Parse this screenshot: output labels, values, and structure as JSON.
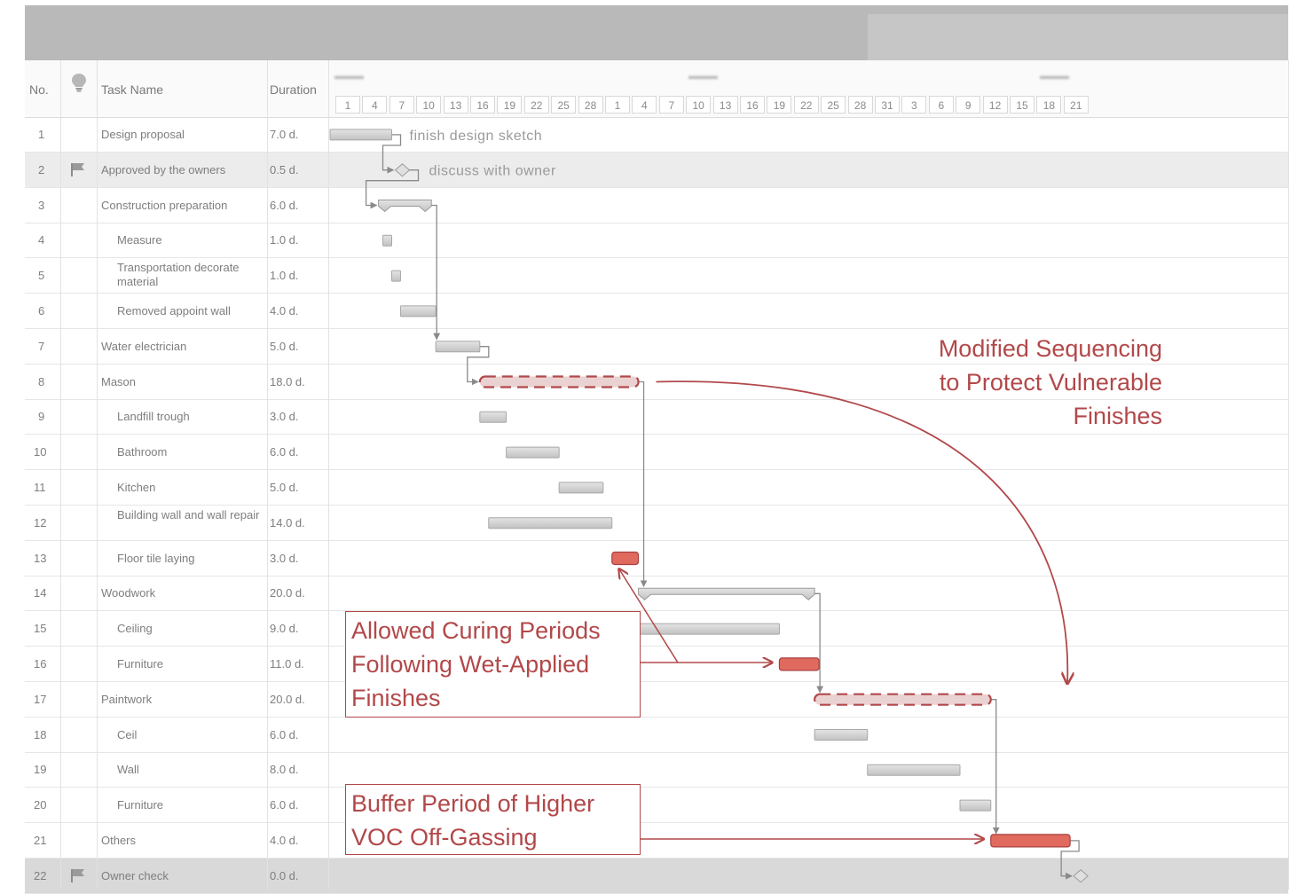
{
  "header": {
    "no_label": "No.",
    "task_label": "Task Name",
    "duration_label": "Duration"
  },
  "timeline": {
    "days": [
      "1",
      "4",
      "7",
      "10",
      "13",
      "16",
      "19",
      "22",
      "25",
      "28",
      "1",
      "4",
      "7",
      "10",
      "13",
      "16",
      "19",
      "22",
      "25",
      "28",
      "31",
      "3",
      "6",
      "9",
      "12",
      "15",
      "18",
      "21"
    ]
  },
  "chart_data": {
    "type": "gantt",
    "tasks": [
      {
        "no": "1",
        "name": "Design proposal",
        "duration": "7.0 d.",
        "level": 0,
        "kind": "task",
        "start": 0,
        "days": 7,
        "label": "finish design sketch"
      },
      {
        "no": "2",
        "name": "Approved by the owners",
        "duration": "0.5 d.",
        "level": 0,
        "kind": "milestone",
        "start": 7,
        "days": 0.5,
        "label": "discuss with owner",
        "flag": true
      },
      {
        "no": "3",
        "name": "Construction preparation",
        "duration": "6.0 d.",
        "level": 0,
        "kind": "summary",
        "start": 5.5,
        "days": 6
      },
      {
        "no": "4",
        "name": "Measure",
        "duration": "1.0 d.",
        "level": 1,
        "kind": "task",
        "start": 6,
        "days": 1
      },
      {
        "no": "5",
        "name": "Transportation decorate material",
        "duration": "1.0 d.",
        "level": 1,
        "kind": "task",
        "start": 7,
        "days": 1
      },
      {
        "no": "6",
        "name": "Removed appoint wall",
        "duration": "4.0 d.",
        "level": 1,
        "kind": "task",
        "start": 8,
        "days": 4
      },
      {
        "no": "7",
        "name": "Water electrician",
        "duration": "5.0 d.",
        "level": 0,
        "kind": "task",
        "start": 12,
        "days": 5
      },
      {
        "no": "8",
        "name": "Mason",
        "duration": "18.0 d.",
        "level": 0,
        "kind": "summary",
        "start": 17,
        "days": 18,
        "highlight": "dashed"
      },
      {
        "no": "9",
        "name": "Landfill trough",
        "duration": "3.0 d.",
        "level": 1,
        "kind": "task",
        "start": 17,
        "days": 3
      },
      {
        "no": "10",
        "name": "Bathroom",
        "duration": "6.0 d.",
        "level": 1,
        "kind": "task",
        "start": 20,
        "days": 6
      },
      {
        "no": "11",
        "name": "Kitchen",
        "duration": "5.0 d.",
        "level": 1,
        "kind": "task",
        "start": 26,
        "days": 5
      },
      {
        "no": "12",
        "name": "Building wall and wall repair",
        "duration": "14.0 d.",
        "level": 1,
        "kind": "task",
        "start": 18,
        "days": 14
      },
      {
        "no": "13",
        "name": "Floor tile laying",
        "duration": "3.0 d.",
        "level": 1,
        "kind": "task",
        "start": 32,
        "days": 3,
        "highlight": "red"
      },
      {
        "no": "14",
        "name": "Woodwork",
        "duration": "20.0 d.",
        "level": 0,
        "kind": "summary",
        "start": 35,
        "days": 20
      },
      {
        "no": "15",
        "name": "Ceiling",
        "duration": "9.0 d.",
        "level": 1,
        "kind": "task",
        "start": 35,
        "days": 16
      },
      {
        "no": "16",
        "name": "Furniture",
        "duration": "11.0 d.",
        "level": 1,
        "kind": "task",
        "start": 51,
        "days": 4.5,
        "highlight": "red"
      },
      {
        "no": "17",
        "name": "Paintwork",
        "duration": "20.0 d.",
        "level": 0,
        "kind": "summary",
        "start": 55,
        "days": 20,
        "highlight": "dashed"
      },
      {
        "no": "18",
        "name": "Ceil",
        "duration": "6.0 d.",
        "level": 1,
        "kind": "task",
        "start": 55,
        "days": 6
      },
      {
        "no": "19",
        "name": "Wall",
        "duration": "8.0 d.",
        "level": 1,
        "kind": "task",
        "start": 61,
        "days": 10.5
      },
      {
        "no": "20",
        "name": "Furniture",
        "duration": "6.0 d.",
        "level": 1,
        "kind": "task",
        "start": 71.5,
        "days": 3.5
      },
      {
        "no": "21",
        "name": "Others",
        "duration": "4.0 d.",
        "level": 0,
        "kind": "task",
        "start": 75,
        "days": 9,
        "highlight": "red"
      },
      {
        "no": "22",
        "name": "Owner check",
        "duration": "0.0 d.",
        "level": 0,
        "kind": "milestone",
        "start": 84,
        "days": 0,
        "flag": true
      }
    ]
  },
  "annotations": {
    "modified": [
      "Modified Sequencing",
      "to Protect Vulnerable",
      "Finishes"
    ],
    "curing": [
      "Allowed Curing Periods",
      "Following Wet-Applied",
      "Finishes"
    ],
    "buffer": [
      "Buffer Period of Higher",
      "VOC Off-Gassing"
    ]
  },
  "colors": {
    "accent": "#b2484a",
    "highlight_fill": "#e06a5e",
    "bar_fill": "#d4d4d4"
  }
}
